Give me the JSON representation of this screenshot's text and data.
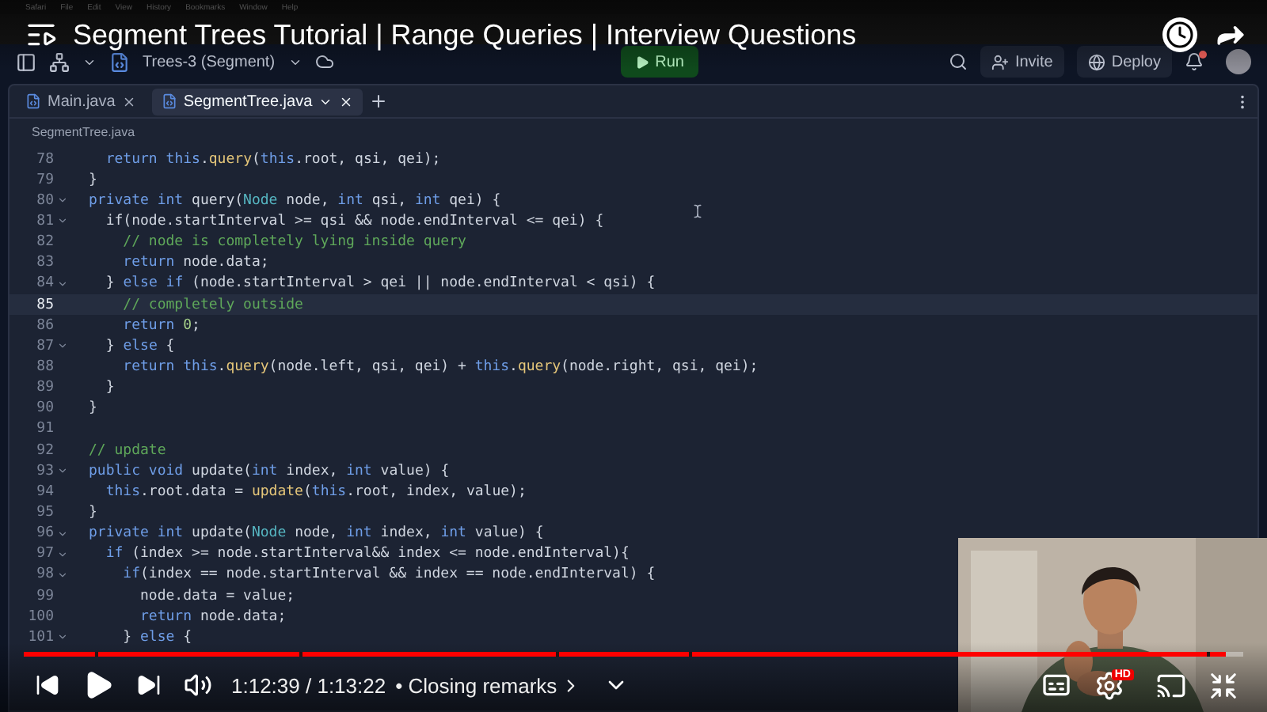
{
  "menubar": {
    "items": [
      "Safari",
      "File",
      "Edit",
      "View",
      "History",
      "Bookmarks",
      "Window",
      "Help"
    ]
  },
  "editor": {
    "project": "Trees-3 (Segment)",
    "run_label": "Run",
    "invite_label": "Invite",
    "deploy_label": "Deploy",
    "notification": true,
    "tabs": [
      {
        "label": "Main.java",
        "selected": false
      },
      {
        "label": "SegmentTree.java",
        "selected": true
      }
    ],
    "breadcrumb": "SegmentTree.java",
    "lines": [
      {
        "num": "78",
        "fold": false,
        "current": false,
        "code": [
          {
            "kind": "keyword",
            "text": "  return "
          },
          {
            "kind": "keyword",
            "text": "this"
          },
          {
            "kind": "plain",
            "text": "."
          },
          {
            "kind": "function",
            "text": "query"
          },
          {
            "kind": "plain",
            "text": "("
          },
          {
            "kind": "keyword",
            "text": "this"
          },
          {
            "kind": "plain",
            "text": ".root, qsi, qei);"
          }
        ]
      },
      {
        "num": "79",
        "fold": false,
        "current": false,
        "code": [
          {
            "kind": "plain",
            "text": "}"
          }
        ]
      },
      {
        "num": "80",
        "fold": true,
        "current": false,
        "code": [
          {
            "kind": "keyword",
            "text": "private int "
          },
          {
            "kind": "plain",
            "text": "query("
          },
          {
            "kind": "type",
            "text": "Node"
          },
          {
            "kind": "plain",
            "text": " node, "
          },
          {
            "kind": "keyword",
            "text": "int "
          },
          {
            "kind": "plain",
            "text": "qsi, "
          },
          {
            "kind": "keyword",
            "text": "int "
          },
          {
            "kind": "plain",
            "text": "qei) {"
          }
        ]
      },
      {
        "num": "81",
        "fold": true,
        "current": false,
        "code": [
          {
            "kind": "plain",
            "text": "  if(node.startInterval >= qsi && node.endInterval <= qei) {"
          }
        ]
      },
      {
        "num": "82",
        "fold": false,
        "current": false,
        "code": [
          {
            "kind": "comment",
            "text": "    // node is completely lying inside query"
          }
        ]
      },
      {
        "num": "83",
        "fold": false,
        "current": false,
        "code": [
          {
            "kind": "keyword",
            "text": "    return "
          },
          {
            "kind": "plain",
            "text": "node.data;"
          }
        ]
      },
      {
        "num": "84",
        "fold": true,
        "current": false,
        "code": [
          {
            "kind": "plain",
            "text": "  } "
          },
          {
            "kind": "keyword",
            "text": "else if "
          },
          {
            "kind": "plain",
            "text": "(node.startInterval > qei || node.endInterval < qsi) {"
          }
        ]
      },
      {
        "num": "85",
        "fold": false,
        "current": true,
        "code": [
          {
            "kind": "comment",
            "text": "    // completely outside"
          }
        ]
      },
      {
        "num": "86",
        "fold": false,
        "current": false,
        "code": [
          {
            "kind": "keyword",
            "text": "    return "
          },
          {
            "kind": "number",
            "text": "0"
          },
          {
            "kind": "plain",
            "text": ";"
          }
        ]
      },
      {
        "num": "87",
        "fold": true,
        "current": false,
        "code": [
          {
            "kind": "plain",
            "text": "  } "
          },
          {
            "kind": "keyword",
            "text": "else "
          },
          {
            "kind": "plain",
            "text": "{"
          }
        ]
      },
      {
        "num": "88",
        "fold": false,
        "current": false,
        "code": [
          {
            "kind": "keyword",
            "text": "    return this"
          },
          {
            "kind": "plain",
            "text": "."
          },
          {
            "kind": "function",
            "text": "query"
          },
          {
            "kind": "plain",
            "text": "(node.left, qsi, qei) + "
          },
          {
            "kind": "keyword",
            "text": "this"
          },
          {
            "kind": "plain",
            "text": "."
          },
          {
            "kind": "function",
            "text": "query"
          },
          {
            "kind": "plain",
            "text": "(node.right, qsi, qei);"
          }
        ]
      },
      {
        "num": "89",
        "fold": false,
        "current": false,
        "code": [
          {
            "kind": "plain",
            "text": "  }"
          }
        ]
      },
      {
        "num": "90",
        "fold": false,
        "current": false,
        "code": [
          {
            "kind": "plain",
            "text": "}"
          }
        ]
      },
      {
        "num": "91",
        "fold": false,
        "current": false
      },
      {
        "num": "92",
        "fold": false,
        "current": false,
        "code": [
          {
            "kind": "comment",
            "text": "// update"
          }
        ]
      },
      {
        "num": "93",
        "fold": true,
        "current": false,
        "code": [
          {
            "kind": "keyword",
            "text": "public void "
          },
          {
            "kind": "plain",
            "text": "update("
          },
          {
            "kind": "keyword",
            "text": "int "
          },
          {
            "kind": "plain",
            "text": "index, "
          },
          {
            "kind": "keyword",
            "text": "int "
          },
          {
            "kind": "plain",
            "text": "value) {"
          }
        ]
      },
      {
        "num": "94",
        "fold": false,
        "current": false,
        "code": [
          {
            "kind": "keyword",
            "text": "  this"
          },
          {
            "kind": "plain",
            "text": ".root.data = "
          },
          {
            "kind": "function",
            "text": "update"
          },
          {
            "kind": "plain",
            "text": "("
          },
          {
            "kind": "keyword",
            "text": "this"
          },
          {
            "kind": "plain",
            "text": ".root, index, value);"
          }
        ]
      },
      {
        "num": "95",
        "fold": false,
        "current": false,
        "code": [
          {
            "kind": "plain",
            "text": "}"
          }
        ]
      },
      {
        "num": "96",
        "fold": true,
        "current": false,
        "code": [
          {
            "kind": "keyword",
            "text": "private int "
          },
          {
            "kind": "plain",
            "text": "update("
          },
          {
            "kind": "type",
            "text": "Node"
          },
          {
            "kind": "plain",
            "text": " node, "
          },
          {
            "kind": "keyword",
            "text": "int "
          },
          {
            "kind": "plain",
            "text": "index, "
          },
          {
            "kind": "keyword",
            "text": "int "
          },
          {
            "kind": "plain",
            "text": "value) {"
          }
        ]
      },
      {
        "num": "97",
        "fold": true,
        "current": false,
        "code": [
          {
            "kind": "keyword",
            "text": "  if "
          },
          {
            "kind": "plain",
            "text": "(index >= node.startInterval&& index <= node.endInterval){"
          }
        ]
      },
      {
        "num": "98",
        "fold": true,
        "current": false,
        "code": [
          {
            "kind": "keyword",
            "text": "    if"
          },
          {
            "kind": "plain",
            "text": "(index == node.startInterval && index == node.endInterval) {"
          }
        ]
      },
      {
        "num": "99",
        "fold": false,
        "current": false,
        "code": [
          {
            "kind": "plain",
            "text": "      node.data = value;"
          }
        ]
      },
      {
        "num": "100",
        "fold": false,
        "current": false,
        "code": [
          {
            "kind": "keyword",
            "text": "      return "
          },
          {
            "kind": "plain",
            "text": "node.data;"
          }
        ]
      },
      {
        "num": "101",
        "fold": true,
        "current": false,
        "code": [
          {
            "kind": "plain",
            "text": "    } "
          },
          {
            "kind": "keyword",
            "text": "else "
          },
          {
            "kind": "plain",
            "text": "{"
          }
        ]
      }
    ]
  },
  "video": {
    "title": "Segment Trees Tutorial | Range Queries | Interview Questions",
    "playing": false,
    "time": "1:12:39 / 1:13:22",
    "chapter": "• Closing remarks",
    "quality_badge": "HD",
    "progress": {
      "level": 0.986
    }
  }
}
